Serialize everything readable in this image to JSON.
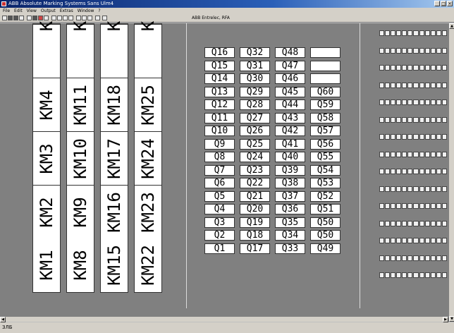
{
  "window": {
    "title": "ABB Absolute Marking Systems Sans Ulm4"
  },
  "menu": [
    "File",
    "Edit",
    "View",
    "Output",
    "Extras",
    "Window",
    "?"
  ],
  "toolbar": {
    "info": "ABB Entrelec, RFA"
  },
  "km_strips": [
    [
      "KM1",
      "KM2",
      "KM3",
      "KM4",
      "K"
    ],
    [
      "KM8",
      "KM9",
      "KM10",
      "KM11",
      "K"
    ],
    [
      "KM15",
      "KM16",
      "KM17",
      "KM18",
      "K"
    ],
    [
      "KM22",
      "KM23",
      "KM24",
      "KM25",
      "K"
    ]
  ],
  "q_columns": [
    [
      "Q16",
      "Q15",
      "Q14",
      "Q13",
      "Q12",
      "Q11",
      "Q10",
      "Q9",
      "Q8",
      "Q7",
      "Q6",
      "Q5",
      "Q4",
      "Q3",
      "Q2",
      "Q1"
    ],
    [
      "Q32",
      "Q31",
      "Q30",
      "Q29",
      "Q28",
      "Q27",
      "Q26",
      "Q25",
      "Q24",
      "Q23",
      "Q22",
      "Q21",
      "Q20",
      "Q19",
      "Q18",
      "Q17"
    ],
    [
      "Q48",
      "Q47",
      "Q46",
      "Q45",
      "Q44",
      "Q43",
      "Q42",
      "Q41",
      "Q40",
      "Q39",
      "Q38",
      "Q37",
      "Q36",
      "Q35",
      "Q34",
      "Q33"
    ],
    [
      "",
      "",
      "",
      "Q60",
      "Q59",
      "Q58",
      "Q57",
      "Q56",
      "Q55",
      "Q54",
      "Q53",
      "Q52",
      "Q51",
      "Q50",
      "Q50",
      "Q49"
    ]
  ],
  "statusbar": {
    "text": "ЗЛБ"
  }
}
